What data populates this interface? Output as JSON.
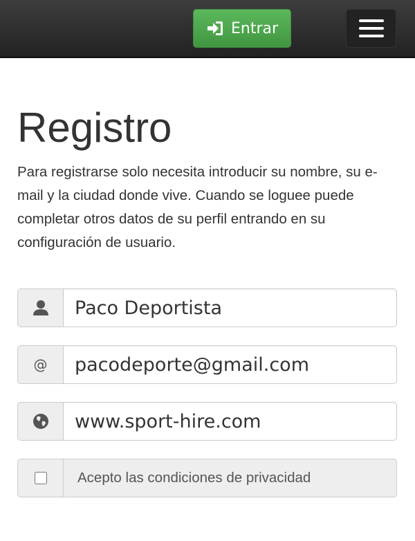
{
  "navbar": {
    "login_label": "Entrar",
    "login_icon": "sign-in-icon",
    "menu_icon": "hamburger-menu-icon",
    "accent_color": "#5cb85c"
  },
  "page": {
    "title": "Registro",
    "intro": "Para registrarse solo necesita introducir su nombre, su e-mail y la ciudad donde vive. Cuando se loguee puede completar otros datos de su perfil entrando en su configuración de usuario."
  },
  "form": {
    "name": {
      "icon": "user-icon",
      "value": "Paco Deportista"
    },
    "email": {
      "icon": "at-icon",
      "addon_text": "@",
      "value": "pacodeporte@gmail.com"
    },
    "website": {
      "icon": "globe-icon",
      "value": "www.sport-hire.com"
    },
    "privacy": {
      "label": "Acepto las condiciones de privacidad",
      "checked": false
    }
  }
}
